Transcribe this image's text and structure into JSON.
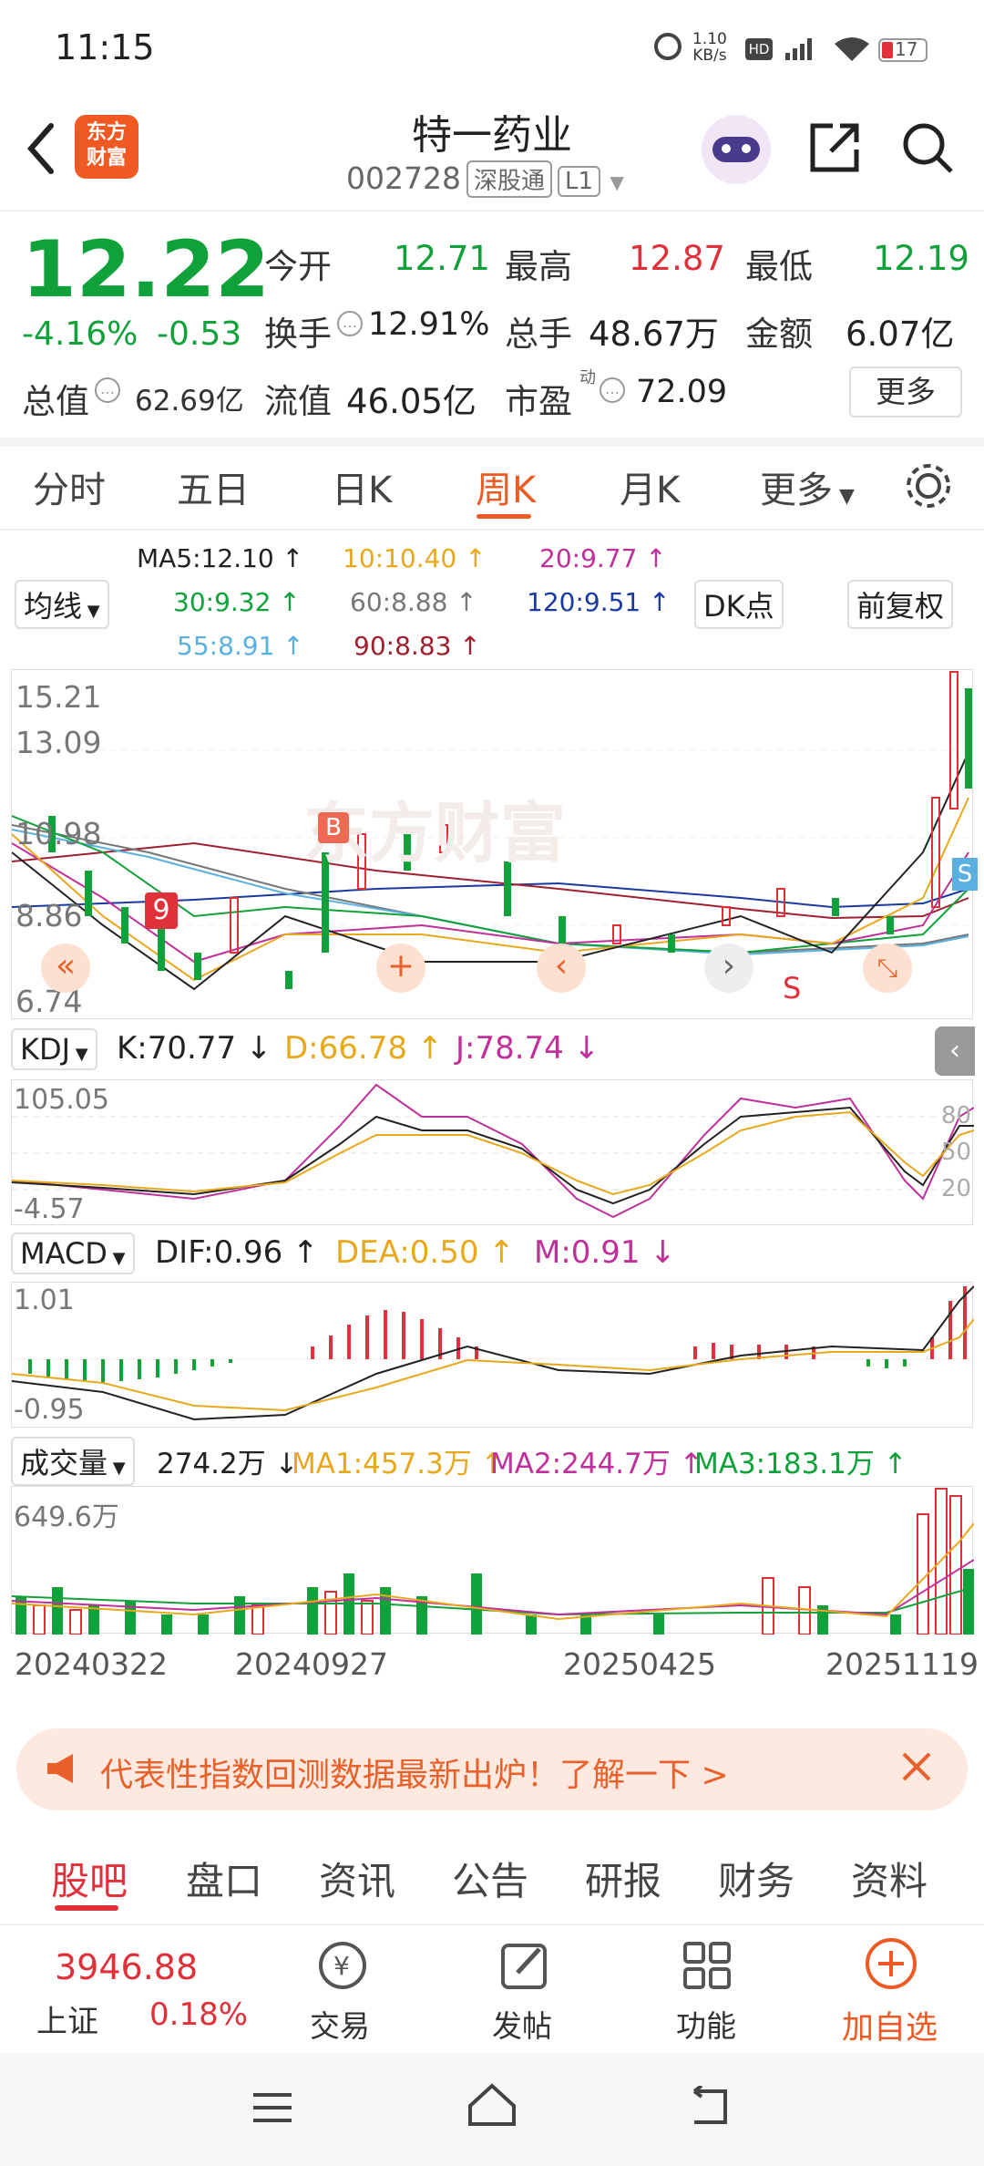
{
  "status": {
    "time": "11:15",
    "net_speed": "1.10\nKB/s",
    "battery": "17"
  },
  "header": {
    "title": "特一药业",
    "code": "002728",
    "tag1": "深股通",
    "tag2": "L1",
    "logo_text": "东方\n财富"
  },
  "quote": {
    "price": "12.22",
    "chg_pct": "-4.16%",
    "chg": "-0.53",
    "open_label": "今开",
    "open": "12.71",
    "high_label": "最高",
    "high": "12.87",
    "low_label": "最低",
    "low": "12.19",
    "turnover_label": "换手",
    "turnover": "12.91%",
    "vol_label": "总手",
    "vol": "48.67万",
    "amt_label": "金额",
    "amt": "6.07亿",
    "mcap_label": "总值",
    "mcap": "62.69亿",
    "float_label": "流值",
    "float": "46.05亿",
    "pe_label": "市盈",
    "pe_sup": "动",
    "pe": "72.09",
    "more": "更多"
  },
  "tabs": {
    "t1": "分时",
    "t2": "五日",
    "t3": "日K",
    "t4": "周K",
    "t5": "月K",
    "t6": "更多"
  },
  "ma": {
    "selector": "均线",
    "ma5": "MA5:12.10 ↑",
    "ma10": "10:10.40 ↑",
    "ma20": "20:9.77 ↑",
    "ma30": "30:9.32 ↑",
    "ma60": "60:8.88 ↑",
    "ma120": "120:9.51 ↑",
    "ma55": "55:8.91 ↑",
    "ma90": "90:8.83 ↑",
    "dk": "DK点",
    "fq": "前复权"
  },
  "kline": {
    "y1": "15.21",
    "y2": "13.09",
    "y3": "10.98",
    "y4": "8.86",
    "y5": "6.74",
    "watermark": "东方财富",
    "b_mark": "B",
    "s_mark": "S",
    "s_mark2": "S",
    "seq9": "9"
  },
  "kdj": {
    "label": "KDJ",
    "k": "K:70.77 ↓",
    "d": "D:66.78 ↑",
    "j": "J:78.74 ↓",
    "y1": "105.05",
    "y2": "-4.57",
    "r80": "80",
    "r50": "50",
    "r20": "20"
  },
  "macd": {
    "label": "MACD",
    "dif": "DIF:0.96 ↑",
    "dea": "DEA:0.50 ↑",
    "m": "M:0.91 ↓",
    "y1": "1.01",
    "y2": "-0.95"
  },
  "vol": {
    "label": "成交量",
    "v": "274.2万 ↓",
    "ma1": "MA1:457.3万 ↑",
    "ma2": "MA2:244.7万 ↑",
    "ma3": "MA3:183.1万 ↑",
    "y1": "649.6万"
  },
  "dates": {
    "d1": "20240322",
    "d2": "20240927",
    "d3": "20250425",
    "d4": "20251119"
  },
  "banner": {
    "text": "代表性指数回测数据最新出炉！了解一下 >"
  },
  "bottom_tabs": {
    "t1": "股吧",
    "t2": "盘口",
    "t3": "资讯",
    "t4": "公告",
    "t5": "研报",
    "t6": "财务",
    "t7": "资料"
  },
  "dock": {
    "index_value": "3946.88",
    "index_name": "上证",
    "index_chg": "0.18%",
    "trade": "交易",
    "post": "发帖",
    "func": "功能",
    "add": "加自选"
  },
  "colors": {
    "red": "#e0303a",
    "green": "#11a13a",
    "accent": "#ee5a24"
  }
}
